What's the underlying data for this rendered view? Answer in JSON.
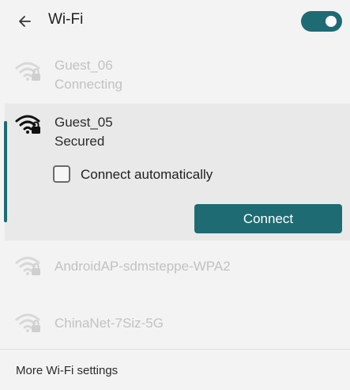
{
  "header": {
    "title": "Wi-Fi",
    "back_icon": "back-arrow-icon",
    "toggle_state": "on"
  },
  "networks": [
    {
      "name": "Guest_06",
      "status": "Connecting",
      "icon": "wifi-secured-icon"
    },
    {
      "name": "Guest_05",
      "status": "Secured",
      "icon": "wifi-secured-icon",
      "selected": true
    },
    {
      "name": "AndroidAP-sdmsteppe-WPA2",
      "icon": "wifi-secured-icon"
    },
    {
      "name": "ChinaNet-7Siz-5G",
      "icon": "wifi-secured-icon"
    }
  ],
  "selected_network": {
    "auto_connect_label": "Connect automatically",
    "auto_connect_checked": false,
    "connect_label": "Connect"
  },
  "footer": {
    "more_settings_label": "More Wi-Fi settings"
  },
  "colors": {
    "accent": "#1e6b73",
    "panel_bg": "#f3f3f3",
    "selected_bg": "#e9e9e9"
  }
}
